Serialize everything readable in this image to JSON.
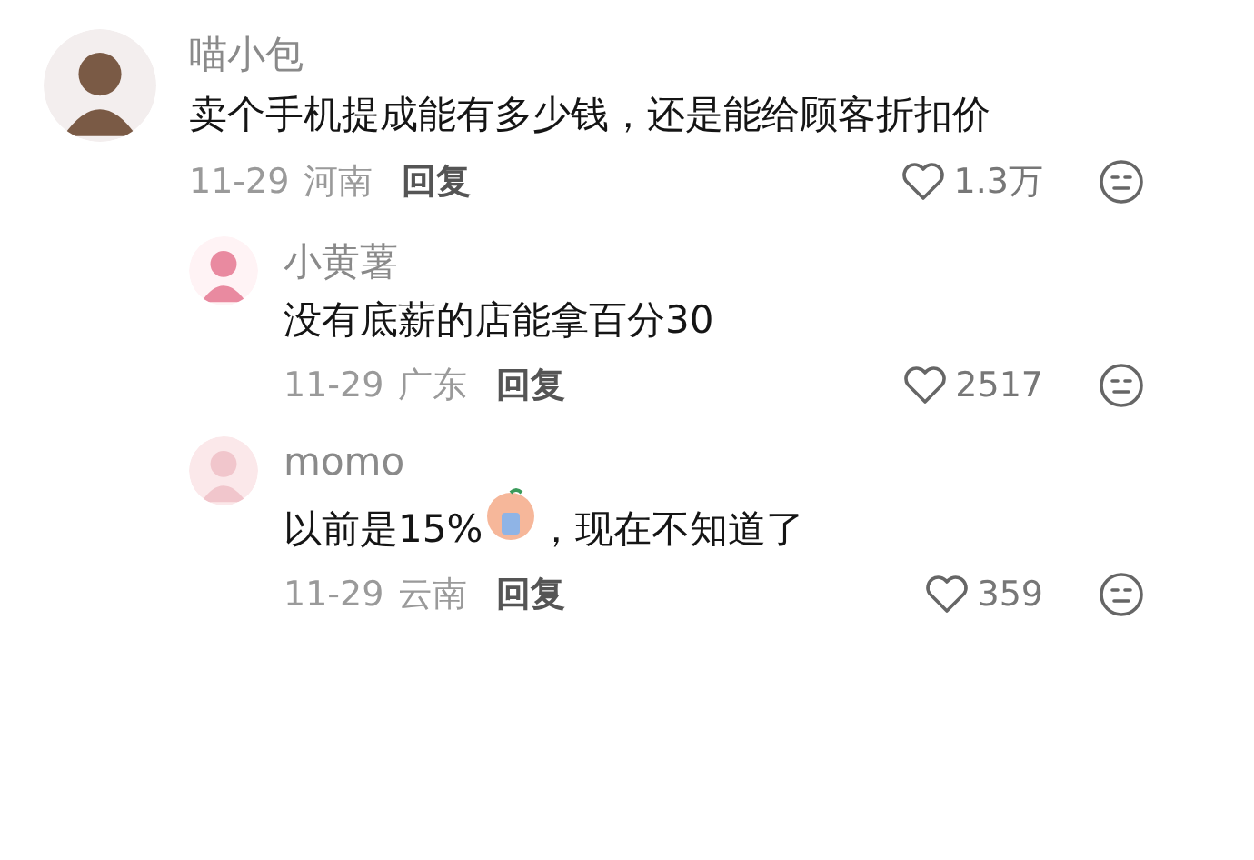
{
  "comments": [
    {
      "author": "喵小包",
      "segments": [
        {
          "kind": "text",
          "text": "卖个手机提成能有多少钱，还是能给顾客折扣价"
        }
      ],
      "date": "11-29",
      "region": "河南",
      "reply_label": "回复",
      "likes": "1.3万",
      "replies": [
        {
          "author": "小黄薯",
          "segments": [
            {
              "kind": "text",
              "text": "没有底薪的店能拿百分30"
            }
          ],
          "date": "11-29",
          "region": "广东",
          "reply_label": "回复",
          "likes": "2517"
        },
        {
          "author": "momo",
          "segments": [
            {
              "kind": "text",
              "text": "以前是15%"
            },
            {
              "kind": "emoji"
            },
            {
              "kind": "text",
              "text": "，现在不知道了"
            }
          ],
          "date": "11-29",
          "region": "云南",
          "reply_label": "回复",
          "likes": "359"
        }
      ]
    }
  ]
}
